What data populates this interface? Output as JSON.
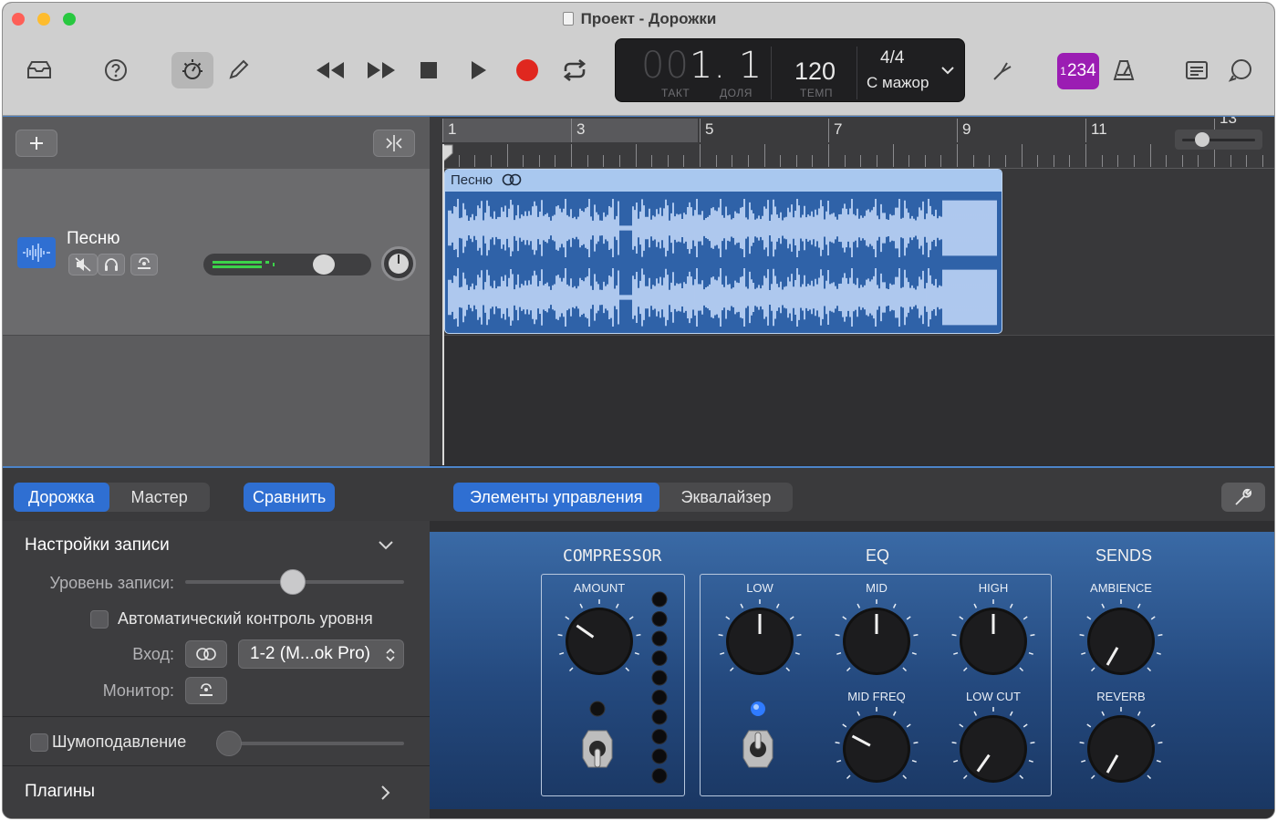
{
  "window": {
    "title": "Проект - Дорожки"
  },
  "lcd": {
    "position_dim": "00",
    "position": "1. 1",
    "bar_label": "ТАКТ",
    "beat_label": "ДОЛЯ",
    "tempo": "120",
    "tempo_label": "ТЕМП",
    "time_signature": "4/4",
    "key": "С мажор"
  },
  "count_in": {
    "small": "1",
    "big": "234"
  },
  "ruler": {
    "bars": [
      "1",
      "3",
      "5",
      "7",
      "9",
      "11",
      "13"
    ]
  },
  "track": {
    "name": "Песню",
    "region_name": "Песню",
    "volume_level": 0.72
  },
  "smart_controls": {
    "tabs_left": [
      "Дорожка",
      "Мастер"
    ],
    "active_left": "Дорожка",
    "compare": "Сравнить",
    "tabs_right": [
      "Элементы управления",
      "Эквалайзер"
    ],
    "active_right": "Элементы управления"
  },
  "inspector": {
    "record_settings": "Настройки записи",
    "record_level": "Уровень записи:",
    "auto_level": "Автоматический контроль уровня",
    "input": "Вход:",
    "input_value": "1-2  (M...ok Pro)",
    "monitor": "Монитор:",
    "noise_gate": "Шумоподавление",
    "plugins": "Плагины"
  },
  "plugin": {
    "compressor": "COMPRESSOR",
    "eq": "EQ",
    "sends": "SENDS",
    "amount": "AMOUNT",
    "low": "LOW",
    "mid": "MID",
    "high": "HIGH",
    "mid_freq": "MID FREQ",
    "low_cut": "LOW CUT",
    "ambience": "AMBIENCE",
    "reverb": "REVERB"
  },
  "colors": {
    "accent": "#2f6fd2",
    "record": "#e0271f",
    "region": "#2f62a8",
    "count_in": "#9b1db3",
    "meter": "#3cd24a"
  },
  "icons": {
    "library": "library-icon",
    "help": "help-icon",
    "smart_controls": "smart-controls-icon",
    "editors": "pencil-icon",
    "rewind": "rewind-icon",
    "forward": "fast-forward-icon",
    "stop": "stop-icon",
    "play": "play-icon",
    "record": "record-icon",
    "cycle": "cycle-icon",
    "tuner": "tuner-icon",
    "metronome": "metronome-icon",
    "notepad": "notepad-icon",
    "loops": "loop-browser-icon"
  }
}
